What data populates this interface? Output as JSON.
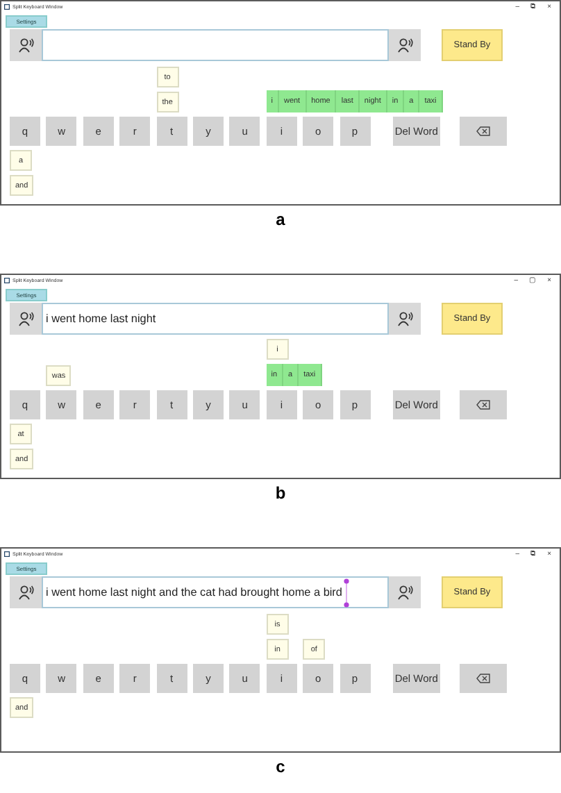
{
  "panels": [
    {
      "label": "a",
      "window": {
        "title": "Split Keyboard Window",
        "controls": [
          "–",
          "⧉",
          "×"
        ]
      },
      "settings": "Settings",
      "input": {
        "handles": false
      },
      "standby": "Stand By",
      "keys": [
        {
          "kind": "letter",
          "label": "q",
          "below": [
            {
              "kind": "word",
              "words": [
                "a"
              ]
            },
            {
              "kind": "word",
              "words": [
                "and"
              ]
            }
          ]
        },
        {
          "kind": "letter",
          "label": "w"
        },
        {
          "kind": "letter",
          "label": "e"
        },
        {
          "kind": "letter",
          "label": "r"
        },
        {
          "kind": "letter",
          "label": "t",
          "above": [
            {
              "kind": "word",
              "words": [
                "to"
              ]
            },
            {
              "kind": "word",
              "words": [
                "the"
              ]
            }
          ]
        },
        {
          "kind": "letter",
          "label": "y"
        },
        {
          "kind": "letter",
          "label": "u"
        },
        {
          "kind": "letter",
          "label": "i",
          "above": [
            {
              "kind": "phrase",
              "words": [
                "i",
                "went",
                "home",
                "last",
                "night",
                "in",
                "a",
                "taxi"
              ]
            }
          ]
        },
        {
          "kind": "letter",
          "label": "o"
        },
        {
          "kind": "letter",
          "label": "p"
        },
        {
          "kind": "text",
          "label": "Del Word"
        },
        {
          "kind": "backspace"
        }
      ]
    },
    {
      "label": "b",
      "window": {
        "title": "Split Keyboard Window",
        "controls": [
          "–",
          "▢",
          "×"
        ]
      },
      "settings": "Settings",
      "input": {
        "value": "i went home last night",
        "handles": false
      },
      "standby": "Stand By",
      "keys": [
        {
          "kind": "letter",
          "label": "q",
          "below": [
            {
              "kind": "word",
              "words": [
                "at"
              ]
            },
            {
              "kind": "word",
              "words": [
                "and"
              ]
            }
          ]
        },
        {
          "kind": "letter",
          "label": "w",
          "above": [
            {
              "kind": "word",
              "words": [
                "was"
              ]
            }
          ]
        },
        {
          "kind": "letter",
          "label": "e"
        },
        {
          "kind": "letter",
          "label": "r"
        },
        {
          "kind": "letter",
          "label": "t"
        },
        {
          "kind": "letter",
          "label": "y"
        },
        {
          "kind": "letter",
          "label": "u"
        },
        {
          "kind": "letter",
          "label": "i",
          "above": [
            {
              "kind": "word",
              "words": [
                "i"
              ]
            },
            {
              "kind": "phrase",
              "words": [
                "in",
                "a",
                "taxi"
              ]
            }
          ]
        },
        {
          "kind": "letter",
          "label": "o"
        },
        {
          "kind": "letter",
          "label": "p"
        },
        {
          "kind": "text",
          "label": "Del Word"
        },
        {
          "kind": "backspace"
        }
      ]
    },
    {
      "label": "c",
      "window": {
        "title": "Split Keyboard Window",
        "controls": [
          "–",
          "⧉",
          "×"
        ]
      },
      "settings": "Settings",
      "input": {
        "value": "i went home last night and the cat had brought home a bird",
        "handles": true
      },
      "standby": "Stand By",
      "keys": [
        {
          "kind": "letter",
          "label": "q",
          "below": [
            {
              "kind": "word",
              "words": [
                "and"
              ]
            }
          ]
        },
        {
          "kind": "letter",
          "label": "w"
        },
        {
          "kind": "letter",
          "label": "e"
        },
        {
          "kind": "letter",
          "label": "r"
        },
        {
          "kind": "letter",
          "label": "t"
        },
        {
          "kind": "letter",
          "label": "y"
        },
        {
          "kind": "letter",
          "label": "u"
        },
        {
          "kind": "letter",
          "label": "i",
          "above": [
            {
              "kind": "word",
              "words": [
                "is"
              ]
            },
            {
              "kind": "word",
              "words": [
                "in"
              ]
            }
          ]
        },
        {
          "kind": "letter",
          "label": "o",
          "above": [
            {
              "kind": "word",
              "words": [
                "of"
              ]
            }
          ]
        },
        {
          "kind": "letter",
          "label": "p"
        },
        {
          "kind": "text",
          "label": "Del Word"
        },
        {
          "kind": "backspace"
        }
      ]
    }
  ]
}
